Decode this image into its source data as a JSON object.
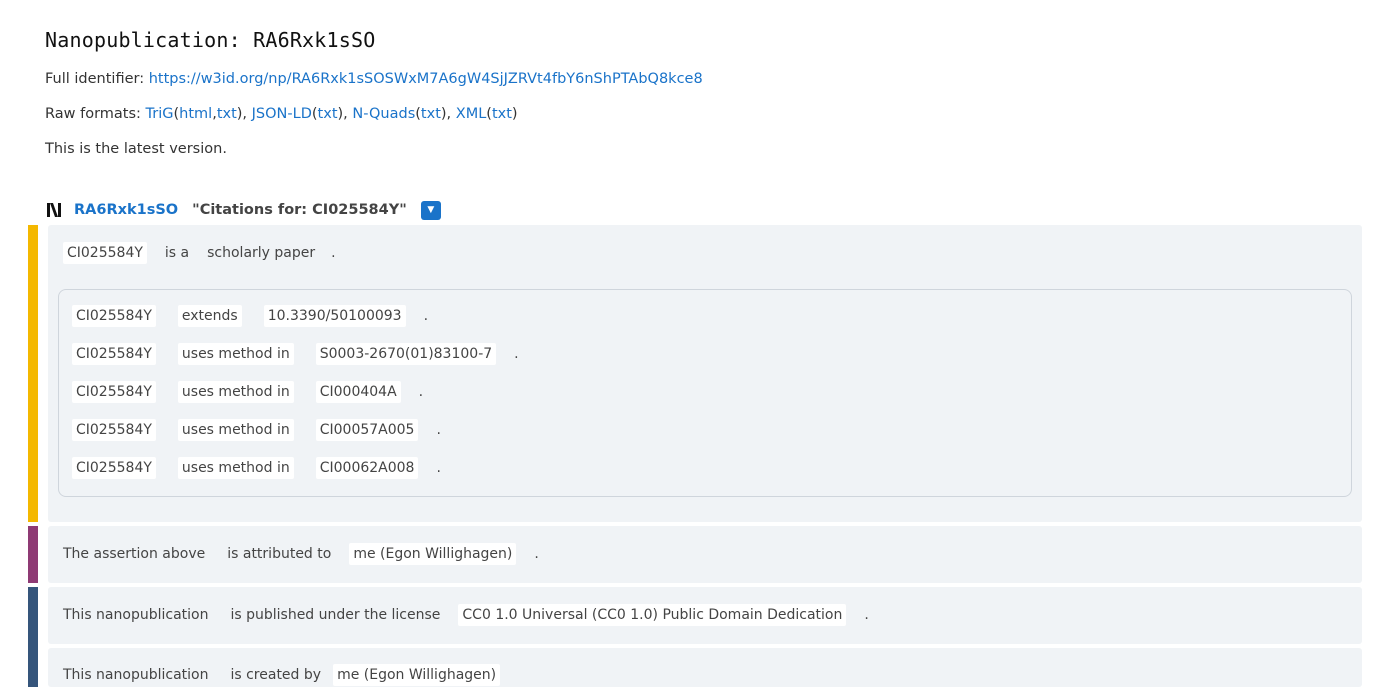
{
  "page": {
    "title": "Nanopublication: RA6Rxk1sSO",
    "identifier_label": "Full identifier:",
    "identifier_url": "https://w3id.org/np/RA6Rxk1sSOSWxM7A6gW4SjJZRVt4fbY6nShPTAbQ8kce8",
    "raw_label": "Raw formats:",
    "raw_formats": [
      {
        "name": "TriG",
        "variants": [
          "html",
          "txt"
        ]
      },
      {
        "name": "JSON-LD",
        "variants": [
          "txt"
        ]
      },
      {
        "name": "N-Quads",
        "variants": [
          "txt"
        ]
      },
      {
        "name": "XML",
        "variants": [
          "txt"
        ]
      }
    ],
    "version_note": "This is the latest version."
  },
  "nanopub": {
    "short_id": "RA6Rxk1sSO",
    "label": "\"Citations for: CI025584Y\"",
    "toggle_icon": "chevron-down-icon",
    "assertion": {
      "color": "#f4b800",
      "top_triple": {
        "subject": "CI025584Y",
        "predicate": "is a",
        "object": "scholarly paper",
        "end": "."
      },
      "inner_triples": [
        {
          "subject": "CI025584Y",
          "predicate": "extends",
          "object": "10.3390/50100093",
          "end": "."
        },
        {
          "subject": "CI025584Y",
          "predicate": "uses method in",
          "object": "S0003-2670(01)83100-7",
          "end": "."
        },
        {
          "subject": "CI025584Y",
          "predicate": "uses method in",
          "object": "CI000404A",
          "end": "."
        },
        {
          "subject": "CI025584Y",
          "predicate": "uses method in",
          "object": "CI00057A005",
          "end": "."
        },
        {
          "subject": "CI025584Y",
          "predicate": "uses method in",
          "object": "CI00062A008",
          "end": "."
        }
      ]
    },
    "provenance": {
      "color": "#8e3a74",
      "triple": {
        "subject": "The assertion above",
        "predicate": "is attributed to",
        "object": "me (Egon Willighagen)",
        "end": "."
      }
    },
    "pubinfo": {
      "color": "#35557b",
      "triples": [
        {
          "subject": "This nanopublication",
          "predicate": "is published under the license",
          "object": "CC0 1.0 Universal (CC0 1.0) Public Domain Dedication",
          "end": "."
        },
        {
          "subject": "This nanopublication",
          "predicate": "is created by",
          "object": "me (Egon Willighagen)",
          "end": ""
        }
      ]
    }
  }
}
